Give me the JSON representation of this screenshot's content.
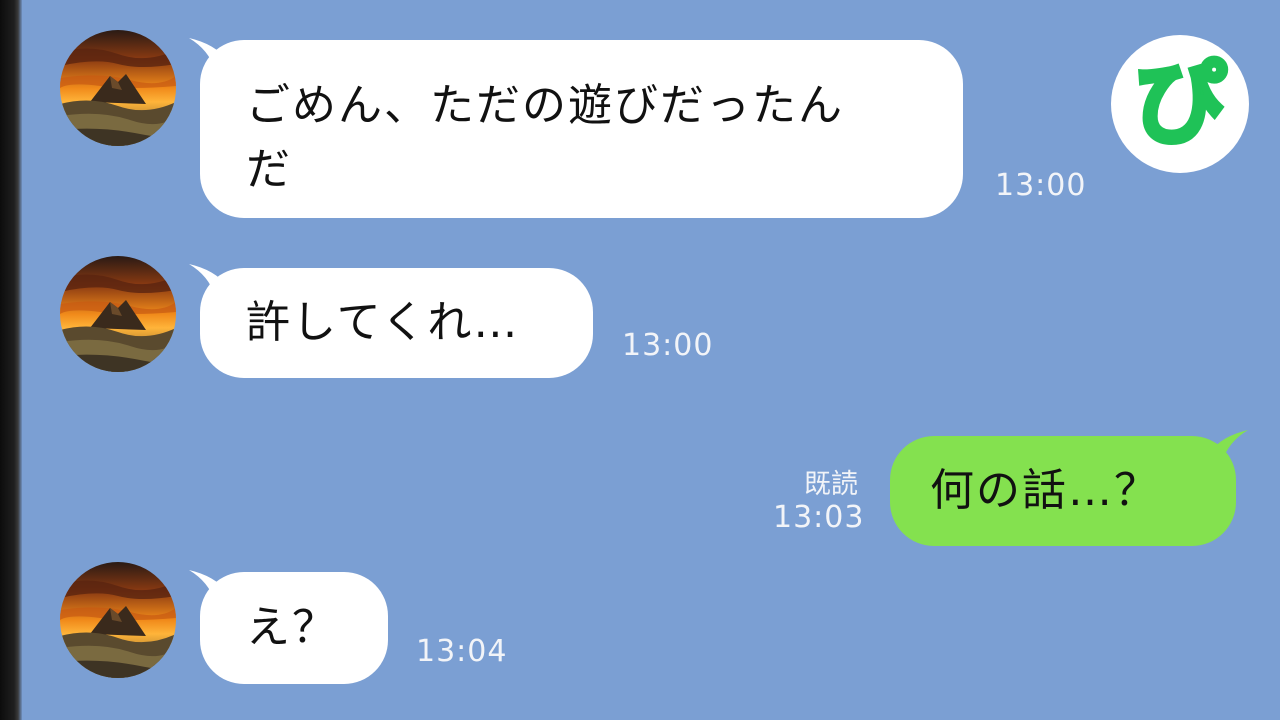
{
  "chat": {
    "messages": [
      {
        "side": "incoming",
        "text_line1": "ごめん、ただの遊びだったん",
        "text_line2": "だ",
        "time": "13:00"
      },
      {
        "side": "incoming",
        "text": "許してくれ…",
        "time": "13:00"
      },
      {
        "side": "outgoing",
        "text": "何の話…？",
        "read_label": "既読",
        "time": "13:03"
      },
      {
        "side": "incoming",
        "text": "え？",
        "time": "13:04"
      }
    ]
  },
  "logo": {
    "glyph": "ぴ",
    "color": "#1fc257"
  },
  "colors": {
    "background": "#7b9fd3",
    "incoming_bubble": "#ffffff",
    "outgoing_bubble": "#84e14f",
    "meta_text": "#f2f4f8"
  },
  "icons": {
    "avatar": "mountain-sunset-avatar",
    "logo": "pi-logo-icon"
  }
}
